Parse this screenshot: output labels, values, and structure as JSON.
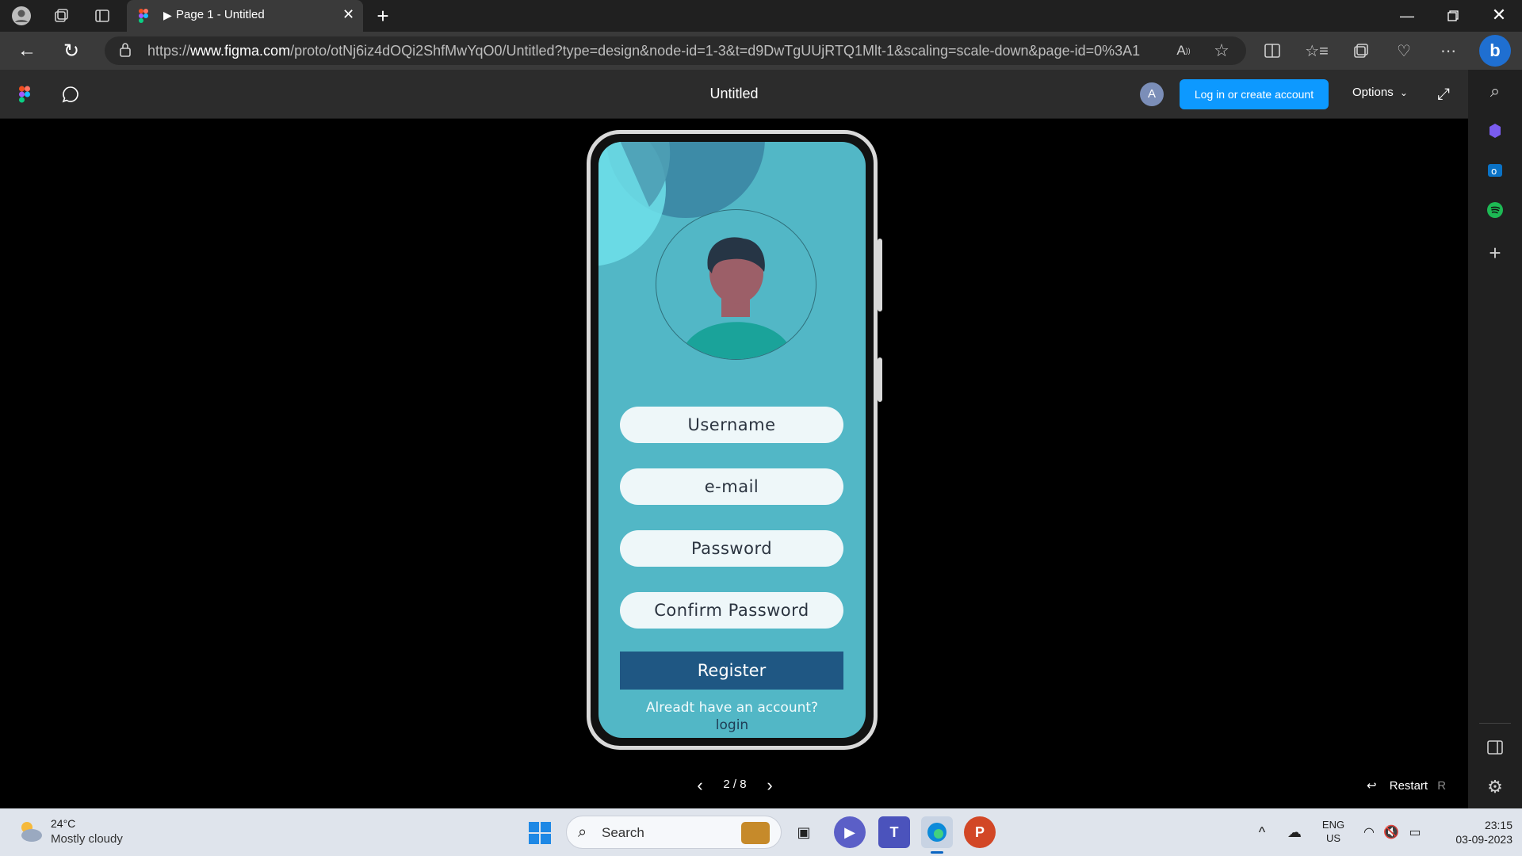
{
  "browser": {
    "tab_title": "Page 1 - Untitled",
    "url_prefix": "https://",
    "url_domain": "www.figma.com",
    "url_rest": "/proto/otNj6iz4dOQi2ShfMwYqO0/Untitled?type=design&node-id=1-3&t=d9DwTgUUjRTQ1Mlt-1&scaling=scale-down&page-id=0%3A1"
  },
  "figma": {
    "title": "Untitled",
    "avatar_letter": "A",
    "login_button": "Log in or create account",
    "options_label": "Options",
    "pagination": "2 / 8",
    "restart_label": "Restart",
    "restart_key": "R"
  },
  "form": {
    "username": "Username",
    "email": "e-mail",
    "password": "Password",
    "confirm_password": "Confirm Password",
    "register": "Register",
    "already_account": "Alreadt have an account?",
    "login": "login"
  },
  "taskbar": {
    "weather_temp": "24°C",
    "weather_desc": "Mostly cloudy",
    "search_placeholder": "Search",
    "lang_top": "ENG",
    "lang_bottom": "US",
    "time": "23:15",
    "date": "03-09-2023"
  },
  "colors": {
    "screen_bg": "#52b7c6",
    "register_bg": "#1f5783",
    "login_button_bg": "#0d99ff"
  }
}
